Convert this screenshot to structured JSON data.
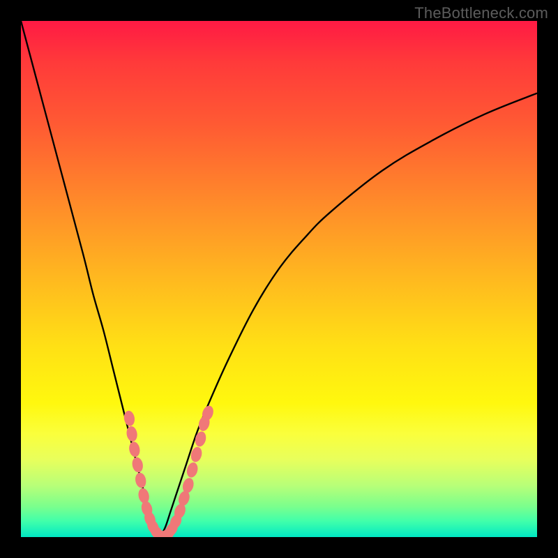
{
  "watermark": "TheBottleneck.com",
  "chart_data": {
    "type": "line",
    "title": "",
    "xlabel": "",
    "ylabel": "",
    "xlim": [
      0,
      100
    ],
    "ylim": [
      0,
      100
    ],
    "grid": false,
    "legend": false,
    "series": [
      {
        "name": "left-curve",
        "x": [
          0,
          4,
          8,
          12,
          14,
          16,
          18,
          20,
          21,
          22,
          23,
          24,
          25,
          26,
          27
        ],
        "y": [
          100,
          85,
          70,
          55,
          47,
          40,
          32,
          24,
          20,
          16,
          12,
          8,
          4,
          1,
          0
        ]
      },
      {
        "name": "right-curve",
        "x": [
          27,
          28,
          29,
          30,
          32,
          34,
          36,
          40,
          45,
          50,
          55,
          60,
          70,
          80,
          90,
          100
        ],
        "y": [
          0,
          2,
          5,
          8,
          14,
          20,
          25,
          34,
          44,
          52,
          58,
          63,
          71,
          77,
          82,
          86
        ]
      }
    ],
    "highlight_points": {
      "name": "salmon-dots",
      "color": "#f07878",
      "points": [
        {
          "x": 21.0,
          "y": 23
        },
        {
          "x": 21.5,
          "y": 20
        },
        {
          "x": 22.0,
          "y": 17
        },
        {
          "x": 22.6,
          "y": 14
        },
        {
          "x": 23.2,
          "y": 11
        },
        {
          "x": 23.8,
          "y": 8
        },
        {
          "x": 24.4,
          "y": 5.5
        },
        {
          "x": 25.0,
          "y": 3.5
        },
        {
          "x": 25.6,
          "y": 2
        },
        {
          "x": 26.3,
          "y": 0.9
        },
        {
          "x": 27.0,
          "y": 0.3
        },
        {
          "x": 27.8,
          "y": 0.2
        },
        {
          "x": 28.5,
          "y": 0.6
        },
        {
          "x": 29.2,
          "y": 1.5
        },
        {
          "x": 30.0,
          "y": 3
        },
        {
          "x": 30.8,
          "y": 5
        },
        {
          "x": 31.6,
          "y": 7.5
        },
        {
          "x": 32.4,
          "y": 10
        },
        {
          "x": 33.2,
          "y": 13
        },
        {
          "x": 34.0,
          "y": 16
        },
        {
          "x": 34.8,
          "y": 19
        },
        {
          "x": 35.5,
          "y": 22
        },
        {
          "x": 36.2,
          "y": 24
        }
      ]
    },
    "gradient_bands": [
      {
        "y_range": [
          96,
          100
        ],
        "color": "#00e8c3"
      },
      {
        "y_range": [
          90,
          96
        ],
        "color": "#7cff8c"
      },
      {
        "y_range": [
          80,
          90
        ],
        "color": "#e8ff5c"
      },
      {
        "y_range": [
          63,
          80
        ],
        "color": "#fff80e"
      },
      {
        "y_range": [
          35,
          63
        ],
        "color": "#ffb91f"
      },
      {
        "y_range": [
          8,
          35
        ],
        "color": "#ff5a33"
      },
      {
        "y_range": [
          0,
          8
        ],
        "color": "#ff1a44"
      }
    ]
  }
}
